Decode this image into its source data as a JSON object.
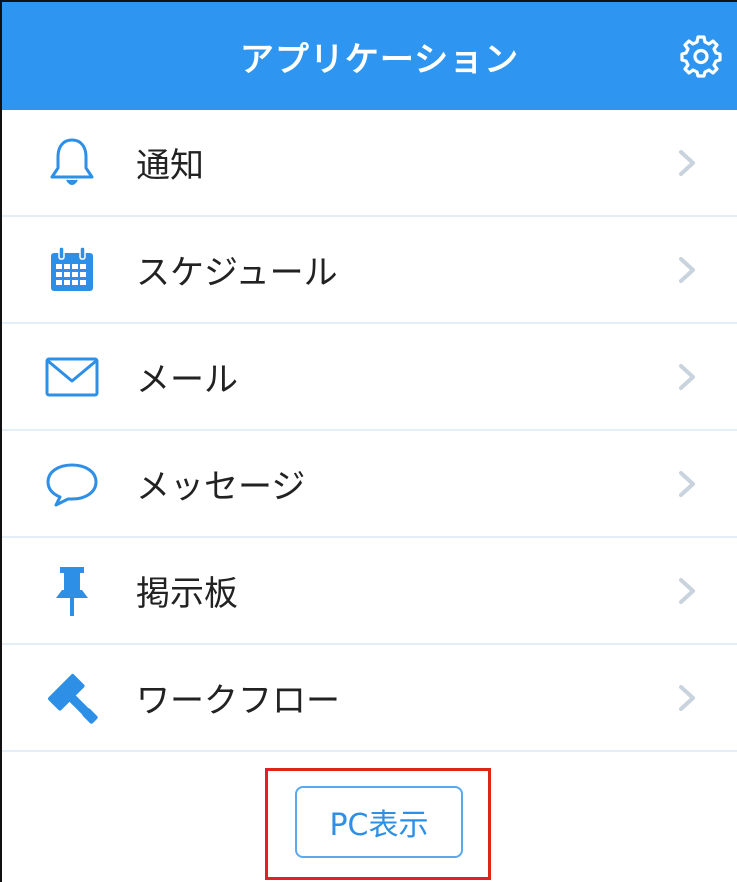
{
  "header": {
    "title": "アプリケーション",
    "settings_icon": "gear-icon",
    "background_color": "#2e96f0"
  },
  "menu": {
    "items": [
      {
        "label": "通知",
        "icon": "bell-icon"
      },
      {
        "label": "スケジュール",
        "icon": "calendar-icon"
      },
      {
        "label": "メール",
        "icon": "envelope-icon"
      },
      {
        "label": "メッセージ",
        "icon": "speech-bubble-icon"
      },
      {
        "label": "掲示板",
        "icon": "pushpin-icon"
      },
      {
        "label": "ワークフロー",
        "icon": "gavel-icon"
      }
    ]
  },
  "footer": {
    "pc_view_label": "PC表示",
    "highlight_color": "#e0231d"
  }
}
